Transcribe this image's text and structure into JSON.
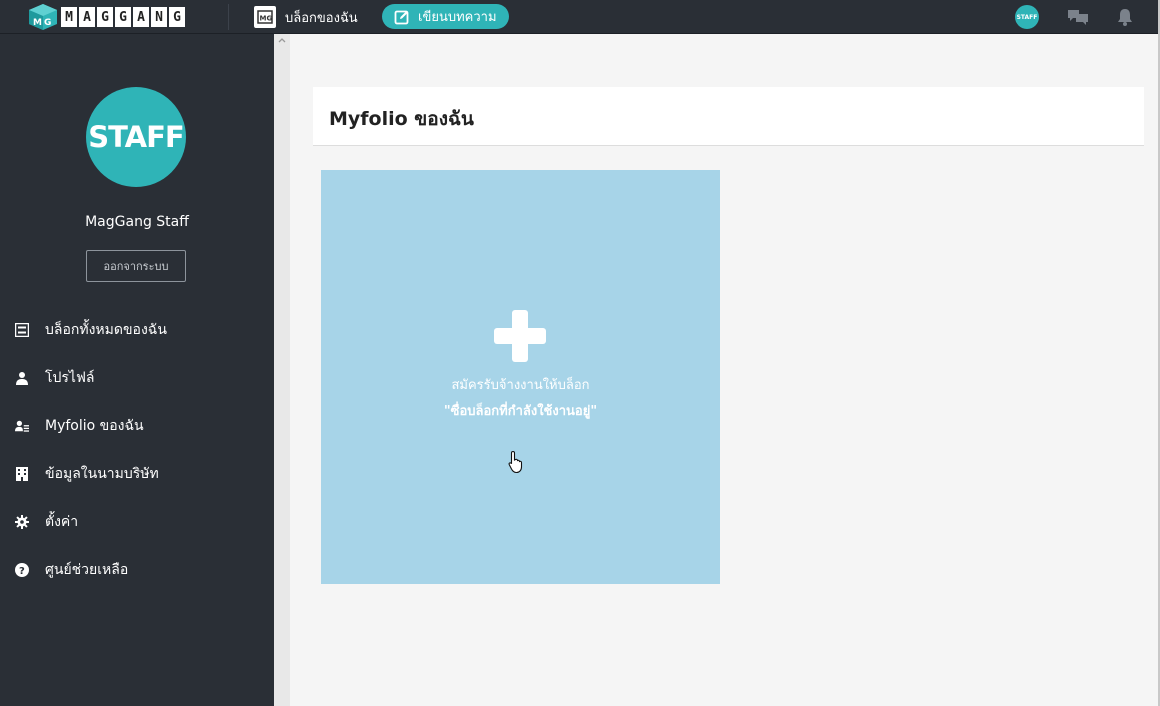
{
  "header": {
    "logo_letters": [
      "M",
      "A",
      "G",
      "G",
      "A",
      "N",
      "G"
    ],
    "my_blog_label": "บล็อกของฉัน",
    "write_button_label": "เขียนบทความ",
    "avatar_text": "STAFF",
    "colors": {
      "topbar": "#2a2f36",
      "accent": "#2fb4b7"
    }
  },
  "sidebar": {
    "avatar_text": "STAFF",
    "user_name": "MagGang Staff",
    "logout_label": "ออกจากระบบ",
    "items": [
      {
        "label": "บล็อกทั้งหมดของฉัน",
        "icon": "list-icon"
      },
      {
        "label": "โปรไฟล์",
        "icon": "user-icon"
      },
      {
        "label": "Myfolio ของฉัน",
        "icon": "user-card-icon"
      },
      {
        "label": "ข้อมูลในนามบริษัท",
        "icon": "building-icon"
      },
      {
        "label": "ตั้งค่า",
        "icon": "gear-icon"
      },
      {
        "label": "ศูนย์ช่วยเหลือ",
        "icon": "help-icon"
      }
    ]
  },
  "main": {
    "page_title": "Myfolio ของฉัน",
    "add_card": {
      "line1": "สมัครรับจ้างงานให้บล็อก",
      "line2": "\"ซื่อบล็อกที่กำลังใช้งานอยู่\"",
      "color": "#a7d4e8"
    }
  }
}
